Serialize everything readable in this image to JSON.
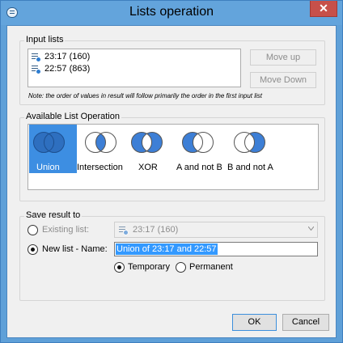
{
  "window": {
    "title": "Lists operation",
    "close_glyph": "✕"
  },
  "input_lists": {
    "label": "Input lists",
    "items": [
      {
        "label": "23:17 (160)",
        "icon": "list-icon"
      },
      {
        "label": "22:57 (863)",
        "icon": "list-icon"
      }
    ],
    "move_up_label": "Move up",
    "move_down_label": "Move Down",
    "note": "Note: the order of values in result will follow primarily the order in the first input list"
  },
  "operations": {
    "label": "Available List Operation",
    "items": [
      {
        "label": "Union",
        "selected": true
      },
      {
        "label": "Intersection",
        "selected": false
      },
      {
        "label": "XOR",
        "selected": false
      },
      {
        "label": "A and not B",
        "selected": false
      },
      {
        "label": "B and not A",
        "selected": false
      }
    ]
  },
  "save_result": {
    "label": "Save result to",
    "existing_list_label": "Existing list:",
    "existing_list_value": "23:17 (160)",
    "existing_list_checked": false,
    "new_list_label": "New list - Name:",
    "new_list_checked": true,
    "new_list_name": "Union of 23:17 and 22:57",
    "temporary_label": "Temporary",
    "temporary_checked": true,
    "permanent_label": "Permanent",
    "permanent_checked": false
  },
  "buttons": {
    "ok_label": "OK",
    "cancel_label": "Cancel"
  },
  "colors": {
    "selection": "#3d8ee2",
    "venn_fill": "#3d7fd6",
    "title_bar": "#63a4dc",
    "close_button": "#c7504a"
  }
}
